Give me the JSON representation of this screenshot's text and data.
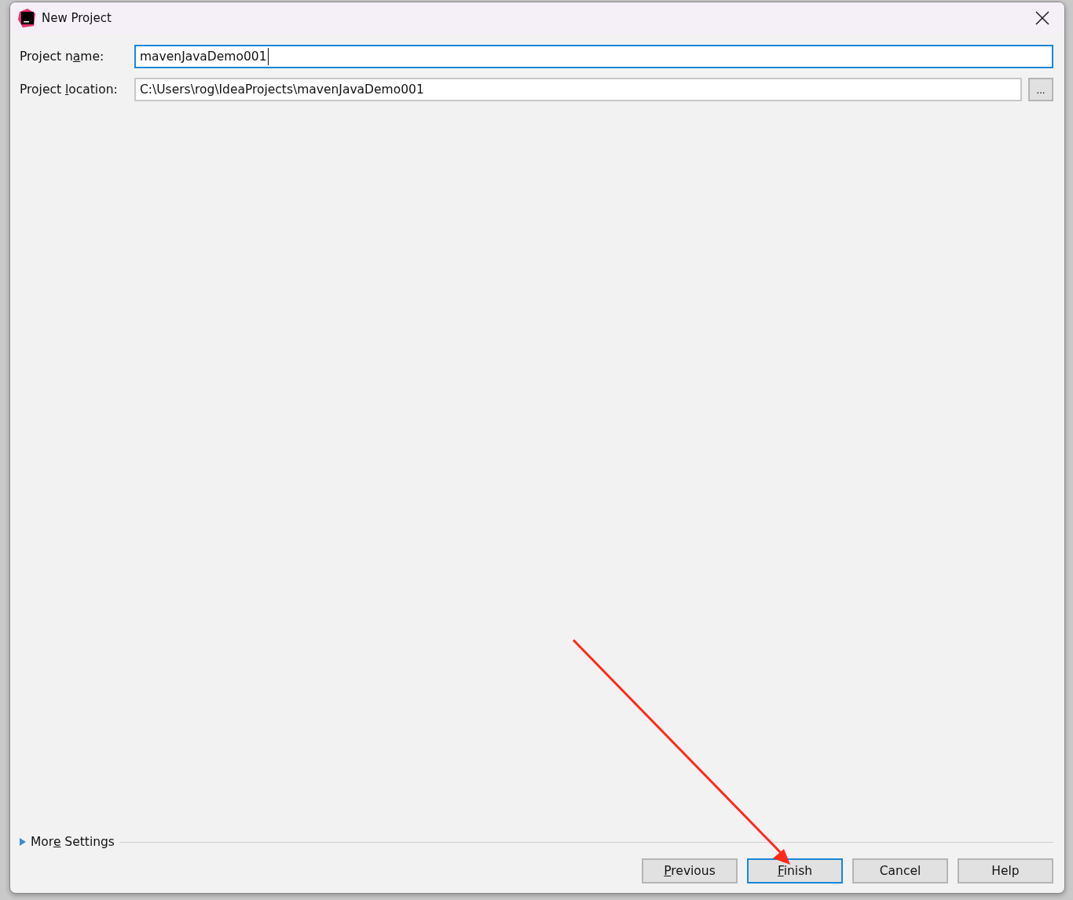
{
  "window": {
    "title": "New Project"
  },
  "fields": [
    {
      "label": {
        "before": "Project n",
        "key": "a",
        "after": "me:"
      },
      "value": "mavenJavaDemo001",
      "focused": true
    },
    {
      "label": {
        "before": "Project ",
        "key": "l",
        "after": "ocation:"
      },
      "value": "C:\\Users\\rog\\IdeaProjects\\mavenJavaDemo001",
      "focused": false,
      "browse_label": "..."
    }
  ],
  "more_settings": {
    "label": {
      "before": "Mor",
      "key": "e",
      "after": " Settings"
    },
    "expanded": false
  },
  "buttons": [
    {
      "label": {
        "key": "P",
        "after": "revious"
      },
      "default": false
    },
    {
      "label": {
        "key": "F",
        "after": "inish"
      },
      "default": true
    },
    {
      "label": {
        "before": "Cancel"
      },
      "default": false
    },
    {
      "label": {
        "before": "Help"
      },
      "default": false
    }
  ]
}
